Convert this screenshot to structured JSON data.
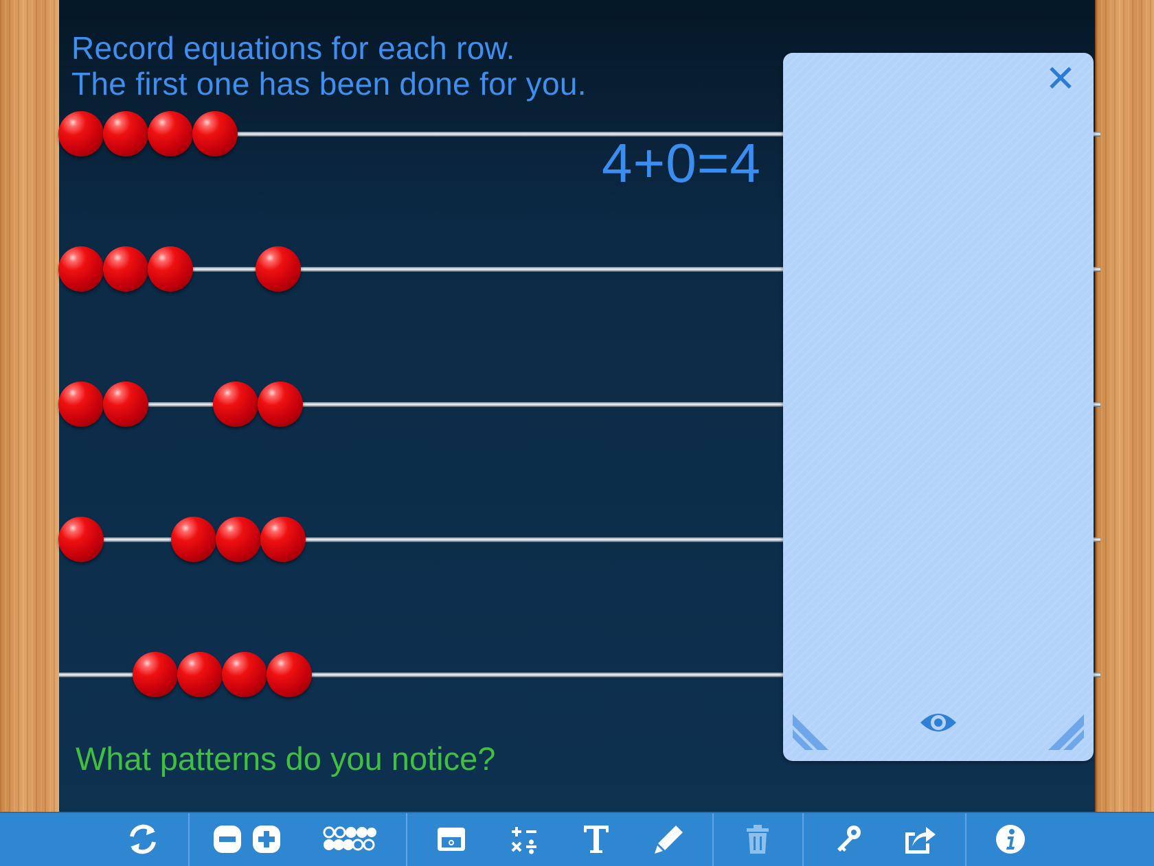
{
  "instructions": {
    "line1": "Record equations for each row.",
    "line2": "The first one has been done for you."
  },
  "equation_row1": "4+0=4",
  "question": "What patterns do you notice?",
  "rows": [
    {
      "left_beads": 4,
      "right_beads": 0
    },
    {
      "left_beads": 3,
      "right_beads": 1
    },
    {
      "left_beads": 2,
      "right_beads": 2
    },
    {
      "left_beads": 1,
      "right_beads": 3
    },
    {
      "left_beads": 0,
      "right_beads": 4
    }
  ],
  "panel": {
    "close_icon": "close-icon",
    "eye_icon": "eye-icon"
  },
  "toolbar": {
    "icons": [
      "reset-icon",
      "minus-icon",
      "plus-icon",
      "beads-layout-icon",
      "equation-box-icon",
      "operations-icon",
      "text-icon",
      "pen-icon",
      "trash-icon",
      "key-icon",
      "share-icon",
      "info-icon"
    ]
  },
  "colors": {
    "bead": "#e30d14",
    "instruction_text": "#3f8ff0",
    "question_text": "#3fc13f",
    "equation_text": "#3a8ef2",
    "panel": "#b3d3fa",
    "toolbar": "#2f86d1"
  }
}
